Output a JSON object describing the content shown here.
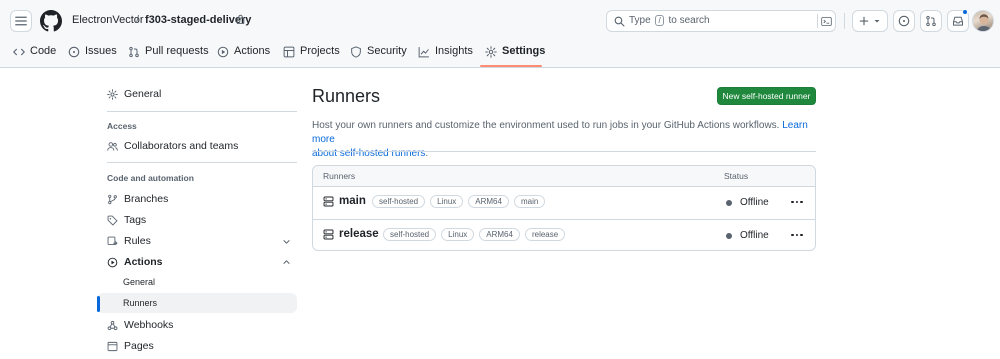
{
  "header": {
    "owner": "ElectronVector",
    "separator": "/",
    "repo": "f303-staged-delivery",
    "search": {
      "before": "Type",
      "key": "/",
      "after": "to search"
    }
  },
  "tabs": [
    {
      "label": "Code",
      "icon": "code-icon"
    },
    {
      "label": "Issues",
      "icon": "issue-icon"
    },
    {
      "label": "Pull requests",
      "icon": "pull-request-icon"
    },
    {
      "label": "Actions",
      "icon": "play-icon"
    },
    {
      "label": "Projects",
      "icon": "table-icon"
    },
    {
      "label": "Security",
      "icon": "shield-icon"
    },
    {
      "label": "Insights",
      "icon": "graph-icon"
    },
    {
      "label": "Settings",
      "icon": "gear-icon",
      "active": true
    }
  ],
  "sidebar": {
    "general": "General",
    "access_heading": "Access",
    "collaborators": "Collaborators and teams",
    "code_heading": "Code and automation",
    "branches": "Branches",
    "tags": "Tags",
    "rules": "Rules",
    "actions": "Actions",
    "actions_general": "General",
    "actions_runners": "Runners",
    "webhooks": "Webhooks",
    "pages": "Pages"
  },
  "main": {
    "title": "Runners",
    "new_button": "New self-hosted runner",
    "description": "Host your own runners and customize the environment used to run jobs in your GitHub Actions workflows.",
    "learn_more_line1": "Learn more",
    "learn_more_line2": "about self-hosted runners",
    "learn_more_period": "."
  },
  "runners_table": {
    "col_runners": "Runners",
    "col_status": "Status",
    "rows": [
      {
        "name": "main",
        "labels": [
          "self-hosted",
          "Linux",
          "ARM64",
          "main"
        ],
        "status": "Offline"
      },
      {
        "name": "release",
        "labels": [
          "self-hosted",
          "Linux",
          "ARM64",
          "release"
        ],
        "status": "Offline"
      }
    ]
  },
  "colors": {
    "accent": "#0969da",
    "primary_button": "#1f883d",
    "tab_underline": "#fd8c73",
    "offline_dot": "#59636e"
  }
}
